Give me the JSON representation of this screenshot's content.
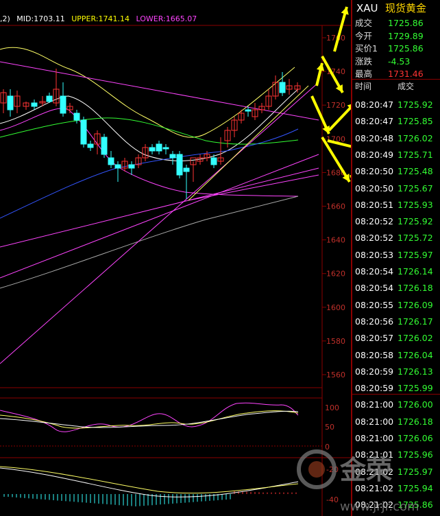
{
  "header": {
    "prefix": ",2)",
    "mid": "MID:1703.11",
    "upper": "UPPER:1741.14",
    "lower": "LOWER:1665.07"
  },
  "price_axis": [
    "1760",
    "1740",
    "1720",
    "1700",
    "1680",
    "1660",
    "1640",
    "1620",
    "1600",
    "1580",
    "1560"
  ],
  "kdj_axis": [
    "100",
    "50",
    "0"
  ],
  "macd_axis": [
    "-20",
    "-40"
  ],
  "quote": {
    "code": "XAU",
    "name": "现货黄金",
    "rows": [
      {
        "label": "成交",
        "value": "1725.86",
        "color": "green"
      },
      {
        "label": "今开",
        "value": "1729.89",
        "color": "green"
      },
      {
        "label": "买价1",
        "value": "1725.86",
        "color": "green"
      },
      {
        "label": "涨跌",
        "value": "-4.53",
        "color": "green"
      },
      {
        "label": "最高",
        "value": "1731.46",
        "color": "red"
      }
    ],
    "col_time": "时间",
    "col_price": "成交",
    "ticks": [
      {
        "time": "08:20:47",
        "price": "1725.92"
      },
      {
        "time": "08:20:47",
        "price": "1725.85"
      },
      {
        "time": "08:20:48",
        "price": "1726.02"
      },
      {
        "time": "08:20:49",
        "price": "1725.71"
      },
      {
        "time": "08:20:50",
        "price": "1725.48"
      },
      {
        "time": "08:20:50",
        "price": "1725.67"
      },
      {
        "time": "08:20:51",
        "price": "1725.93"
      },
      {
        "time": "08:20:52",
        "price": "1725.92"
      },
      {
        "time": "08:20:52",
        "price": "1725.72"
      },
      {
        "time": "08:20:53",
        "price": "1725.97"
      },
      {
        "time": "08:20:54",
        "price": "1726.14"
      },
      {
        "time": "08:20:54",
        "price": "1726.18"
      },
      {
        "time": "08:20:55",
        "price": "1726.09"
      },
      {
        "time": "08:20:56",
        "price": "1726.17"
      },
      {
        "time": "08:20:57",
        "price": "1726.02"
      },
      {
        "time": "08:20:58",
        "price": "1726.04"
      },
      {
        "time": "08:20:59",
        "price": "1726.13"
      },
      {
        "time": "08:20:59",
        "price": "1725.99"
      },
      {
        "time": "08:21:00",
        "price": "1726.00"
      },
      {
        "time": "08:21:00",
        "price": "1726.18"
      },
      {
        "time": "08:21:00",
        "price": "1726.06"
      },
      {
        "time": "08:21:01",
        "price": "1725.96"
      },
      {
        "time": "08:21:02",
        "price": "1725.97"
      },
      {
        "time": "08:21:02",
        "price": "1725.94"
      },
      {
        "time": "08:21:02",
        "price": "1725.86"
      }
    ]
  },
  "watermark": {
    "text": "金荣",
    "url": "www.jrjr.com"
  },
  "colors": {
    "up": "#ff3333",
    "down": "#33ff33",
    "grid": "#8b0000",
    "annotation": "#ffff00"
  }
}
